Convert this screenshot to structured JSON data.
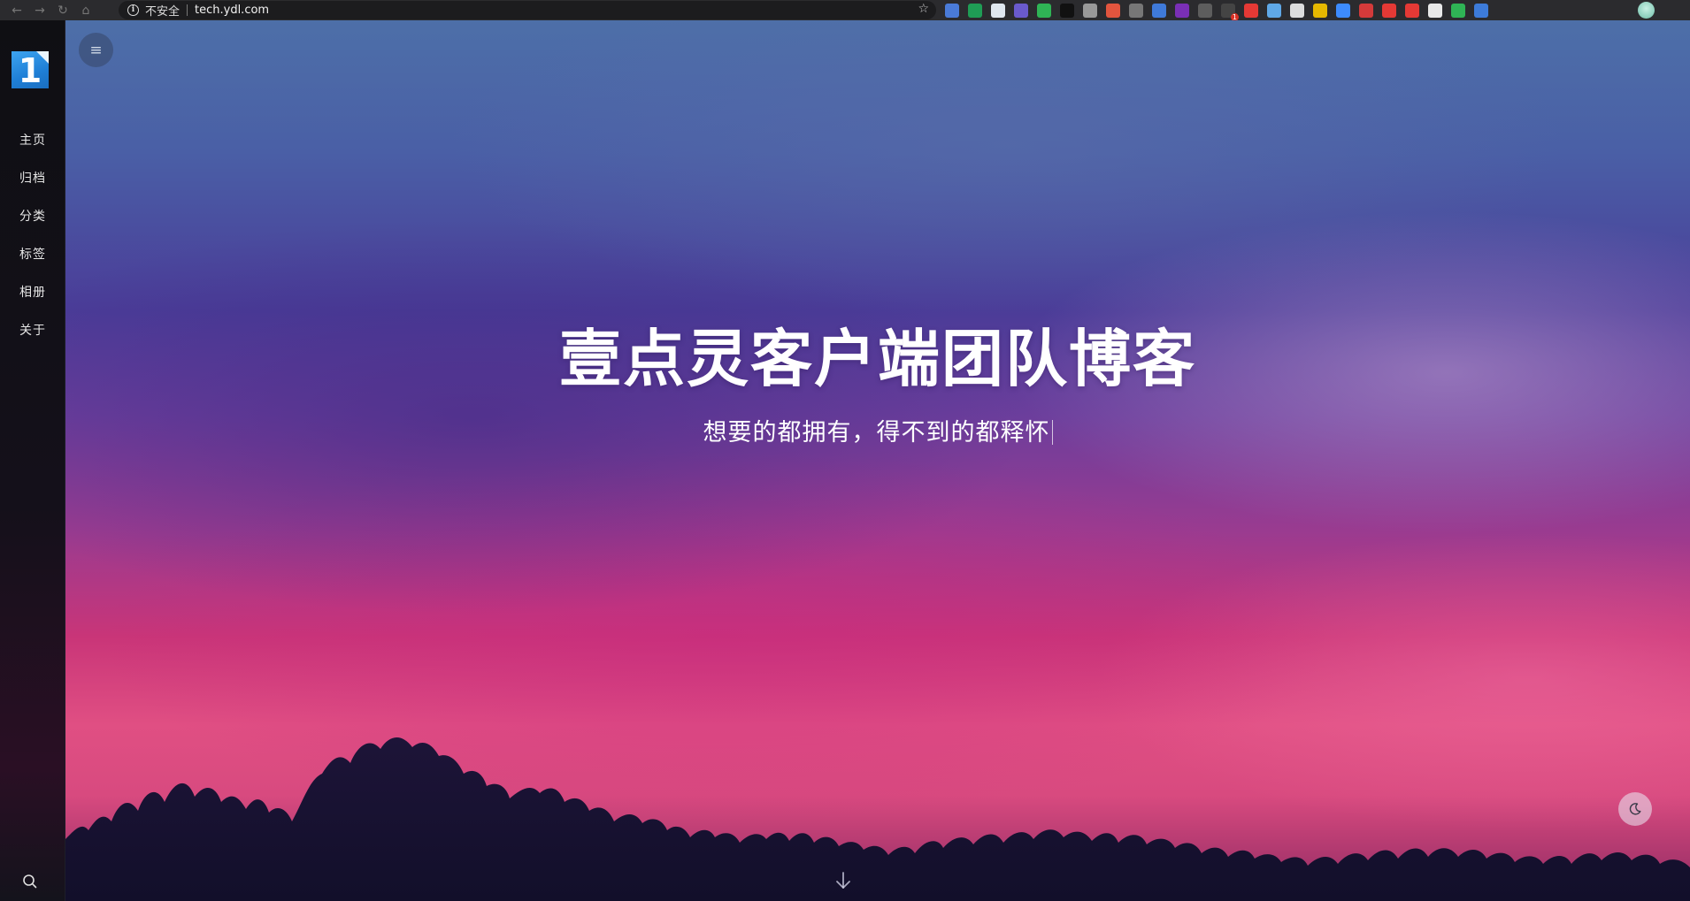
{
  "browser": {
    "security_label": "不安全",
    "url": "tech.ydl.com",
    "extensions": [
      {
        "name": "translate-ext-icon",
        "color": "#4a7bd8"
      },
      {
        "name": "sheet-ext-icon",
        "color": "#1f9d55"
      },
      {
        "name": "gem-ext-icon",
        "color": "#dfe7ef"
      },
      {
        "name": "jh-ext-icon",
        "color": "#6a5acd"
      },
      {
        "name": "evernote-ext-icon",
        "color": "#2fb455"
      },
      {
        "name": "x-ext-icon",
        "color": "#111111"
      },
      {
        "name": "cursor-ext-icon",
        "color": "#999999"
      },
      {
        "name": "grid-ext-icon",
        "color": "#e2553e"
      },
      {
        "name": "camera-ext-icon",
        "color": "#777777"
      },
      {
        "name": "pin-ext-icon",
        "color": "#3f7ad9"
      },
      {
        "name": "rp-ext-icon",
        "color": "#7a2fb5"
      },
      {
        "name": "chart-ext-icon",
        "color": "#5d5d5d"
      },
      {
        "name": "camera-badge-ext-icon",
        "color": "#444444",
        "badge": "1"
      },
      {
        "name": "stop-hand-ext-icon",
        "color": "#e53935"
      },
      {
        "name": "globe-ext-icon",
        "color": "#5fa8e6"
      },
      {
        "name": "cloud-ext-icon",
        "color": "#dddddd"
      },
      {
        "name": "palette-ext-icon",
        "color": "#e6b800"
      },
      {
        "name": "wave-ext-icon",
        "color": "#3d8bfd"
      },
      {
        "name": "feather-ext-icon",
        "color": "#d43a3a"
      },
      {
        "name": "dots-ext-icon",
        "color": "#e53935"
      },
      {
        "name": "location-ext-icon",
        "color": "#e53935"
      },
      {
        "name": "cloud2-ext-icon",
        "color": "#e8e8e8"
      },
      {
        "name": "sync-ext-icon",
        "color": "#2fb455"
      },
      {
        "name": "k-ext-icon",
        "color": "#3d7bd9"
      }
    ]
  },
  "sidebar": {
    "logo_text": "1",
    "items": [
      {
        "label": "主页"
      },
      {
        "label": "归档"
      },
      {
        "label": "分类"
      },
      {
        "label": "标签"
      },
      {
        "label": "相册"
      },
      {
        "label": "关于"
      }
    ]
  },
  "hero": {
    "title": "壹点灵客户端团队博客",
    "subtitle": "想要的都拥有，得不到的都释怀"
  },
  "icons": {
    "menu": "menu-icon",
    "search": "search-icon",
    "scroll": "arrow-down-icon",
    "theme": "moon-icon"
  }
}
